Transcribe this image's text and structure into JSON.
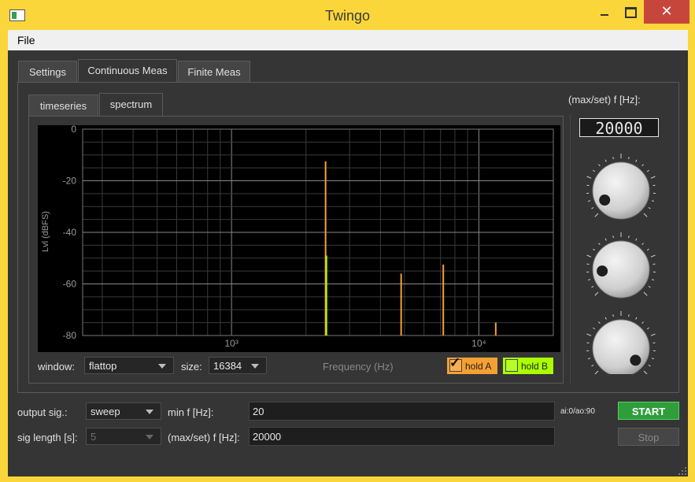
{
  "window": {
    "title": "Twingo",
    "close_glyph": "✕"
  },
  "menu": {
    "file": "File"
  },
  "main_tabs": [
    "Settings",
    "Continuous Meas",
    "Finite Meas"
  ],
  "sub_tabs": [
    "timeseries",
    "spectrum"
  ],
  "chart_data": {
    "type": "bar",
    "xscale": "log",
    "xlim": [
      250,
      20000
    ],
    "ylim": [
      -80,
      0
    ],
    "xlabel": "Frequency (Hz)",
    "ylabel": "Lvl (dBFS)",
    "yticks": [
      "0",
      "-20",
      "-40",
      "-60",
      "-80"
    ],
    "xticks": [
      "10³",
      "10⁴"
    ],
    "grid": true,
    "series": [
      {
        "name": "hold A",
        "color": "#f5a032",
        "x": [
          2400,
          4850,
          7180,
          11700
        ],
        "values": [
          -12.5,
          -56,
          -52.5,
          -75
        ]
      },
      {
        "name": "hold B",
        "color": "#aaff00",
        "x": [
          2410
        ],
        "values": [
          -49
        ]
      }
    ]
  },
  "spectrum_controls": {
    "window_label": "window:",
    "window_value": "flattop",
    "size_label": "size:",
    "size_value": "16384",
    "hold_a": "hold A",
    "hold_b": "hold B",
    "hold_a_color": "#f5a032",
    "hold_b_color": "#aaff00"
  },
  "knob_panel": {
    "title": "(max/set) f [Hz]:",
    "display": "20000"
  },
  "bottom": {
    "output_sig_label": "output sig.:",
    "output_sig_value": "sweep",
    "min_f_label": "min f [Hz]:",
    "min_f_value": "20",
    "sig_length_label": "sig length [s]:",
    "sig_length_value": "5",
    "max_f_label": "(max/set) f [Hz]:",
    "max_f_value": "20000",
    "io_status": "ai:0/ao:90",
    "start_label": "START",
    "stop_label": "Stop"
  }
}
